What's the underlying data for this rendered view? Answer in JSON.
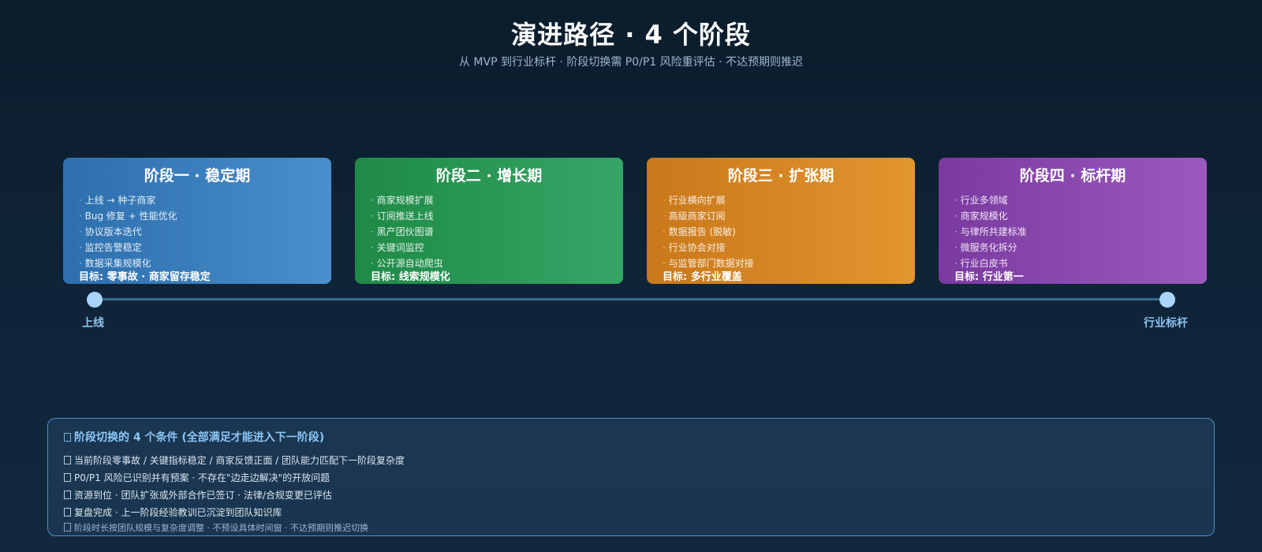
{
  "header": {
    "title": "演进路径 · 4 个阶段",
    "subtitle": "从 MVP 到行业标杆 · 阶段切换需 P0/P1 风险重评估 · 不达预期则推迟"
  },
  "stages": [
    {
      "title": "阶段一 · 稳定期",
      "items": [
        "上线 → 种子商家",
        "Bug 修复 + 性能优化",
        "协议版本迭代",
        "监控告警稳定",
        "数据采集规模化"
      ],
      "goal": "目标: 零事故 · 商家留存稳定",
      "color": "#3a7fbf"
    },
    {
      "title": "阶段二 · 增长期",
      "items": [
        "商家规模扩展",
        "订阅推送上线",
        "黑产团伙图谱",
        "关键词监控",
        "公开源自动爬虫"
      ],
      "goal": "目标: 线索规模化",
      "color": "#2a9856"
    },
    {
      "title": "阶段三 · 扩张期",
      "items": [
        "行业横向扩展",
        "高级商家订阅",
        "数据报告 (脱敏)",
        "行业协会对接",
        "与监管部门数据对接"
      ],
      "goal": "目标: 多行业覆盖",
      "color": "#d68724"
    },
    {
      "title": "阶段四 · 标杆期",
      "items": [
        "行业多领域",
        "商家规模化",
        "与律所共建标准",
        "微服务化拆分",
        "行业白皮书"
      ],
      "goal": "目标: 行业第一",
      "color": "#8a49ae"
    }
  ],
  "timeline": {
    "start_label": "上线",
    "end_label": "行业标杆"
  },
  "conditions": {
    "title": "阶段切换的 4 个条件 (全部满足才能进入下一阶段)",
    "items": [
      "当前阶段零事故 / 关键指标稳定 / 商家反馈正面 / 团队能力匹配下一阶段复杂度",
      "P0/P1 风险已识别并有预案 · 不存在\"边走边解决\"的开放问题",
      "资源到位 · 团队扩张或外部合作已签订 · 法律/合规变更已评估",
      "复盘完成 · 上一阶段经验教训已沉淀到团队知识库"
    ],
    "note": "阶段时长按团队规模与复杂度调整 · 不预设具体时间窗 · 不达预期则推迟切换"
  }
}
